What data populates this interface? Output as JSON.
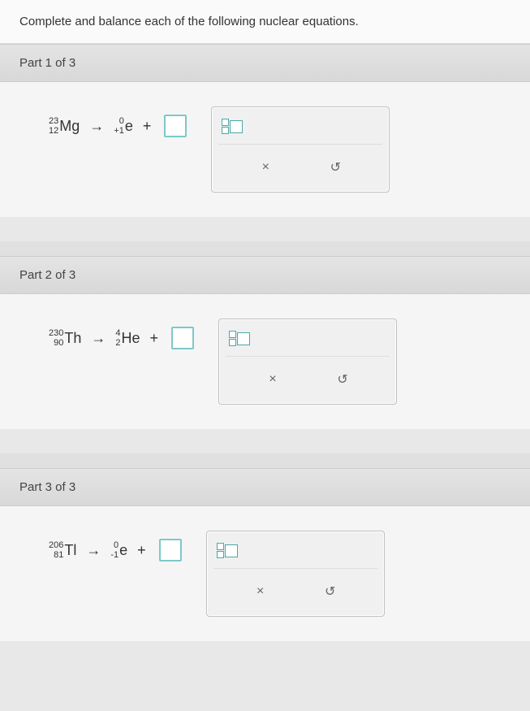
{
  "instruction": "Complete and balance each of the following nuclear equations.",
  "parts": [
    {
      "label": "Part 1 of 3",
      "reactant": {
        "mass": "23",
        "atomic": "12",
        "symbol": "Mg"
      },
      "product": {
        "mass": "0",
        "atomic": "+1",
        "symbol": "e"
      }
    },
    {
      "label": "Part 2 of 3",
      "reactant": {
        "mass": "230",
        "atomic": "90",
        "symbol": "Th"
      },
      "product": {
        "mass": "4",
        "atomic": "2",
        "symbol": "He"
      }
    },
    {
      "label": "Part 3 of 3",
      "reactant": {
        "mass": "206",
        "atomic": "81",
        "symbol": "Tl"
      },
      "product": {
        "mass": "0",
        "atomic": "-1",
        "symbol": "e"
      }
    }
  ],
  "symbols": {
    "arrow": "→",
    "plus": "+",
    "clear": "×",
    "reset": "↺"
  }
}
